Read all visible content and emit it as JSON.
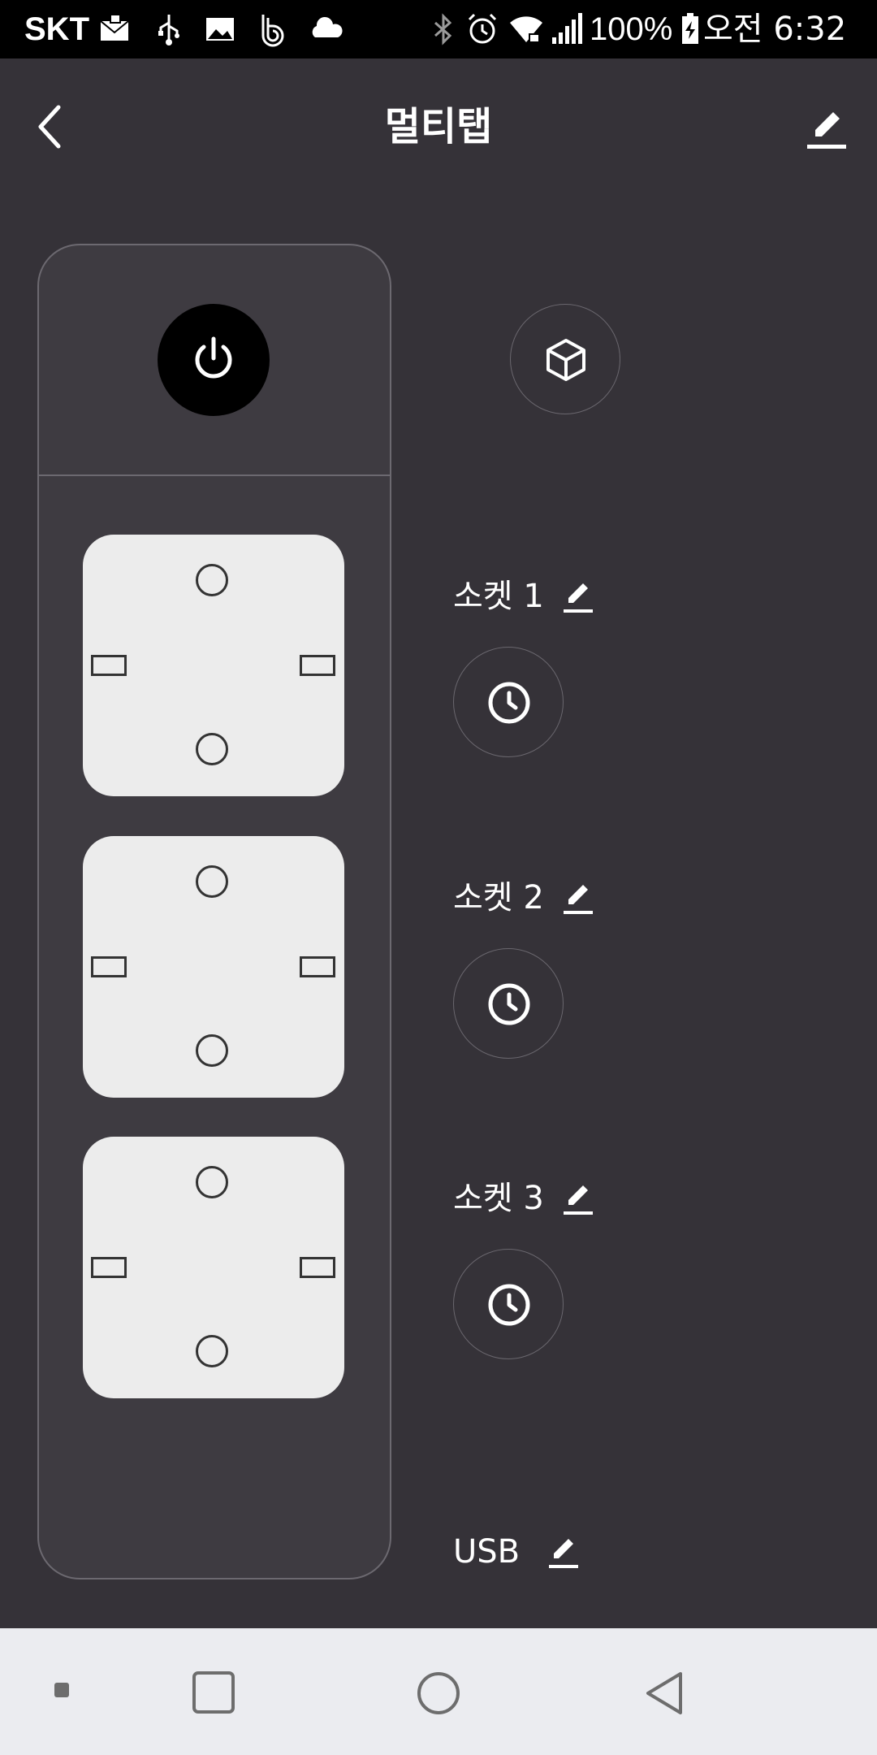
{
  "status_bar": {
    "carrier": "SKT",
    "battery_percent": "100%",
    "time": "오전 6:32",
    "icons": [
      "mail-icon",
      "usb-icon",
      "gallery-icon",
      "b-app-icon",
      "cloud-icon",
      "bluetooth-icon",
      "alarm-icon",
      "wifi-icon",
      "signal-icon",
      "battery-charging-icon"
    ]
  },
  "header": {
    "title": "멀티탭",
    "back_icon": "chevron-left-icon",
    "edit_icon": "pencil-icon"
  },
  "multitap": {
    "power_icon": "power-icon",
    "mode_icon": "cube-icon",
    "sockets": [
      {
        "label": "소켓 1",
        "timer_icon": "clock-icon",
        "edit_icon": "pencil-icon"
      },
      {
        "label": "소켓 2",
        "timer_icon": "clock-icon",
        "edit_icon": "pencil-icon"
      },
      {
        "label": "소켓 3",
        "timer_icon": "clock-icon",
        "edit_icon": "pencil-icon"
      }
    ],
    "usb": {
      "label": "USB",
      "edit_icon": "pencil-icon"
    }
  },
  "nav_bar": {
    "items": [
      "dot-icon",
      "recents-icon",
      "home-icon",
      "back-triangle-icon"
    ]
  },
  "colors": {
    "background": "#353238",
    "panel": "#3e3b41",
    "socket_face": "#ececec",
    "power_button": "#000000",
    "nav_bar": "#ebecf0"
  }
}
